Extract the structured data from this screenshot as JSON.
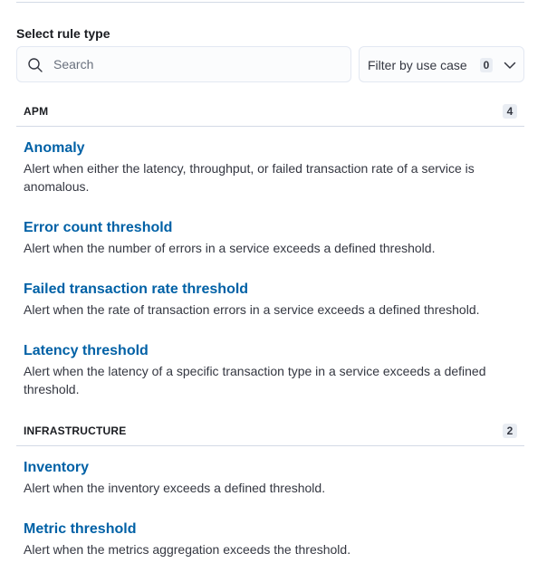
{
  "heading": "Select rule type",
  "search": {
    "placeholder": "Search",
    "value": ""
  },
  "filter": {
    "label": "Filter by use case",
    "count": "0"
  },
  "groups": [
    {
      "title": "APM",
      "count": "4",
      "rules": [
        {
          "title": "Anomaly",
          "description": "Alert when either the latency, throughput, or failed transaction rate of a service is anomalous."
        },
        {
          "title": "Error count threshold",
          "description": "Alert when the number of errors in a service exceeds a defined threshold."
        },
        {
          "title": "Failed transaction rate threshold",
          "description": "Alert when the rate of transaction errors in a service exceeds a defined threshold."
        },
        {
          "title": "Latency threshold",
          "description": "Alert when the latency of a specific transaction type in a service exceeds a defined threshold."
        }
      ]
    },
    {
      "title": "INFRASTRUCTURE",
      "count": "2",
      "rules": [
        {
          "title": "Inventory",
          "description": "Alert when the inventory exceeds a defined threshold."
        },
        {
          "title": "Metric threshold",
          "description": "Alert when the metrics aggregation exceeds the threshold."
        }
      ]
    }
  ]
}
